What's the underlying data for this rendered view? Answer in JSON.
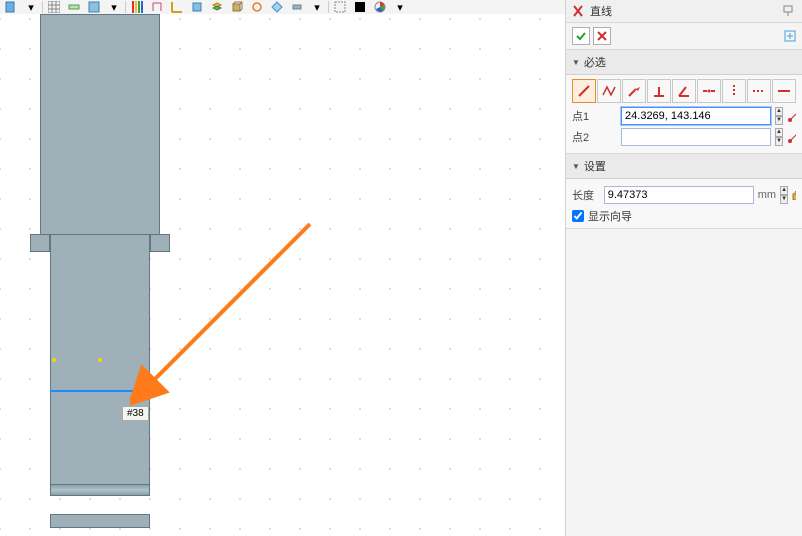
{
  "panel": {
    "title": "直线",
    "section_required": "必选",
    "point1_label": "点1",
    "point1_value": "24.3269, 143.146",
    "point2_label": "点2",
    "point2_value": "",
    "section_settings": "设置",
    "length_label": "长度",
    "length_value": "9.47373",
    "length_unit": "mm",
    "show_guide_label": "显示向导"
  },
  "canvas": {
    "tag_label": "#38"
  }
}
